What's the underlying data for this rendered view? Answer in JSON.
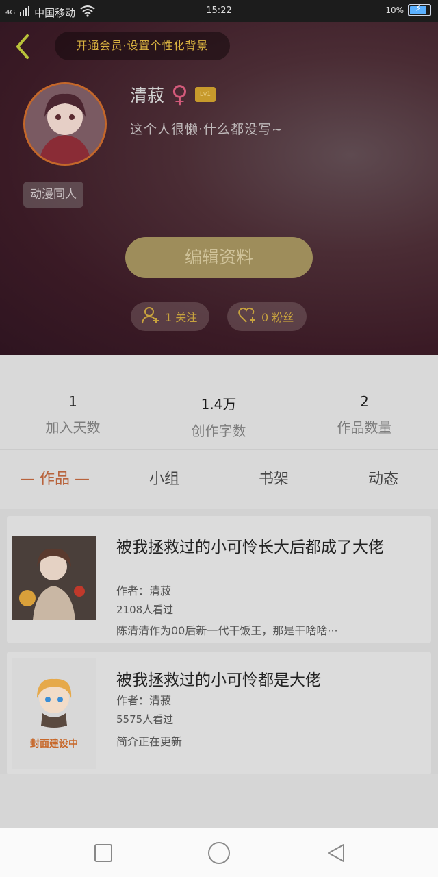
{
  "status_bar": {
    "network": "4G",
    "carrier": "中国移动",
    "time": "15:22",
    "battery": "10%"
  },
  "header": {
    "vip_banner": "开通会员·设置个性化背景",
    "username": "清菽",
    "level": "Lv1",
    "bio": "这个人很懒·什么都没写~",
    "tag": "动漫同人",
    "edit_button": "编辑资料",
    "follow_label": "1 关注",
    "fans_label": "0 粉丝"
  },
  "stats": [
    {
      "value": "1",
      "label": "加入天数"
    },
    {
      "value": "1.4万",
      "label": "创作字数"
    },
    {
      "value": "2",
      "label": "作品数量"
    }
  ],
  "tabs": [
    {
      "label": "— 作品 —",
      "active": true
    },
    {
      "label": "小组",
      "active": false
    },
    {
      "label": "书架",
      "active": false
    },
    {
      "label": "动态",
      "active": false
    }
  ],
  "works": [
    {
      "title": "被我拯救过的小可怜长大后都成了大佬",
      "author": "作者：清菽",
      "views": "2108人看过",
      "intro": "陈清清作为00后新一代干饭王，那是干啥啥···"
    },
    {
      "title": "被我拯救过的小可怜都是大佬",
      "author": "作者：清菽",
      "views": "5575人看过",
      "intro": "简介正在更新",
      "cover_text": "封面建设中"
    }
  ],
  "colors": {
    "accent": "#c7a23e",
    "active_tab": "#b8633c"
  }
}
